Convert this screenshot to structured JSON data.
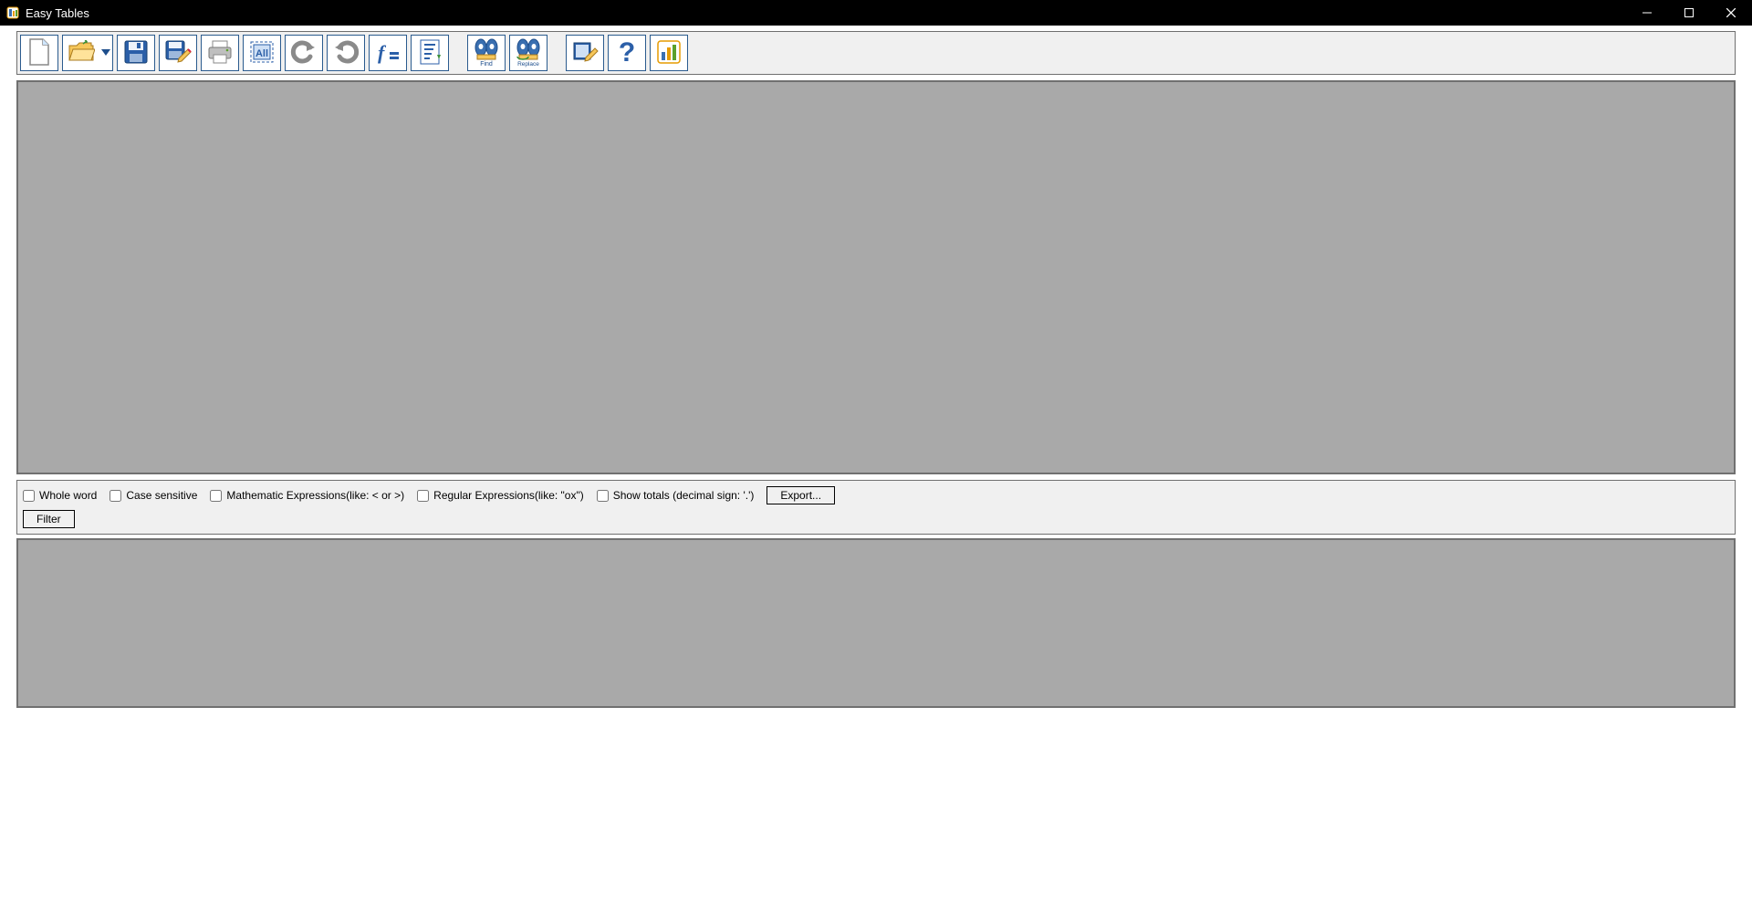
{
  "window": {
    "title": "Easy Tables"
  },
  "toolbar": {
    "items": [
      {
        "name": "new",
        "icon": "new-file-icon"
      },
      {
        "name": "open",
        "icon": "folder-open-icon",
        "split": true
      },
      {
        "name": "save",
        "icon": "save-icon"
      },
      {
        "name": "save-as",
        "icon": "save-edit-icon"
      },
      {
        "name": "print",
        "icon": "print-icon"
      },
      {
        "name": "select-all",
        "icon": "select-all-icon"
      },
      {
        "name": "undo",
        "icon": "undo-icon"
      },
      {
        "name": "redo",
        "icon": "redo-icon"
      },
      {
        "name": "formula",
        "icon": "fx-icon"
      },
      {
        "name": "sort",
        "icon": "sort-icon"
      },
      {
        "name": "find",
        "icon": "find-icon",
        "caption": "Find"
      },
      {
        "name": "replace",
        "icon": "replace-icon",
        "caption": "Replace"
      },
      {
        "name": "options",
        "icon": "options-icon"
      },
      {
        "name": "help",
        "icon": "help-icon"
      },
      {
        "name": "chart",
        "icon": "chart-icon"
      }
    ]
  },
  "filter": {
    "whole_word": "Whole word",
    "case_sensitive": "Case sensitive",
    "math_expr": "Mathematic Expressions(like: < or >)",
    "regex": "Regular Expressions(like: \"ox\")",
    "show_totals": "Show totals (decimal sign: '.')",
    "export_btn": "Export...",
    "filter_btn": "Filter"
  }
}
